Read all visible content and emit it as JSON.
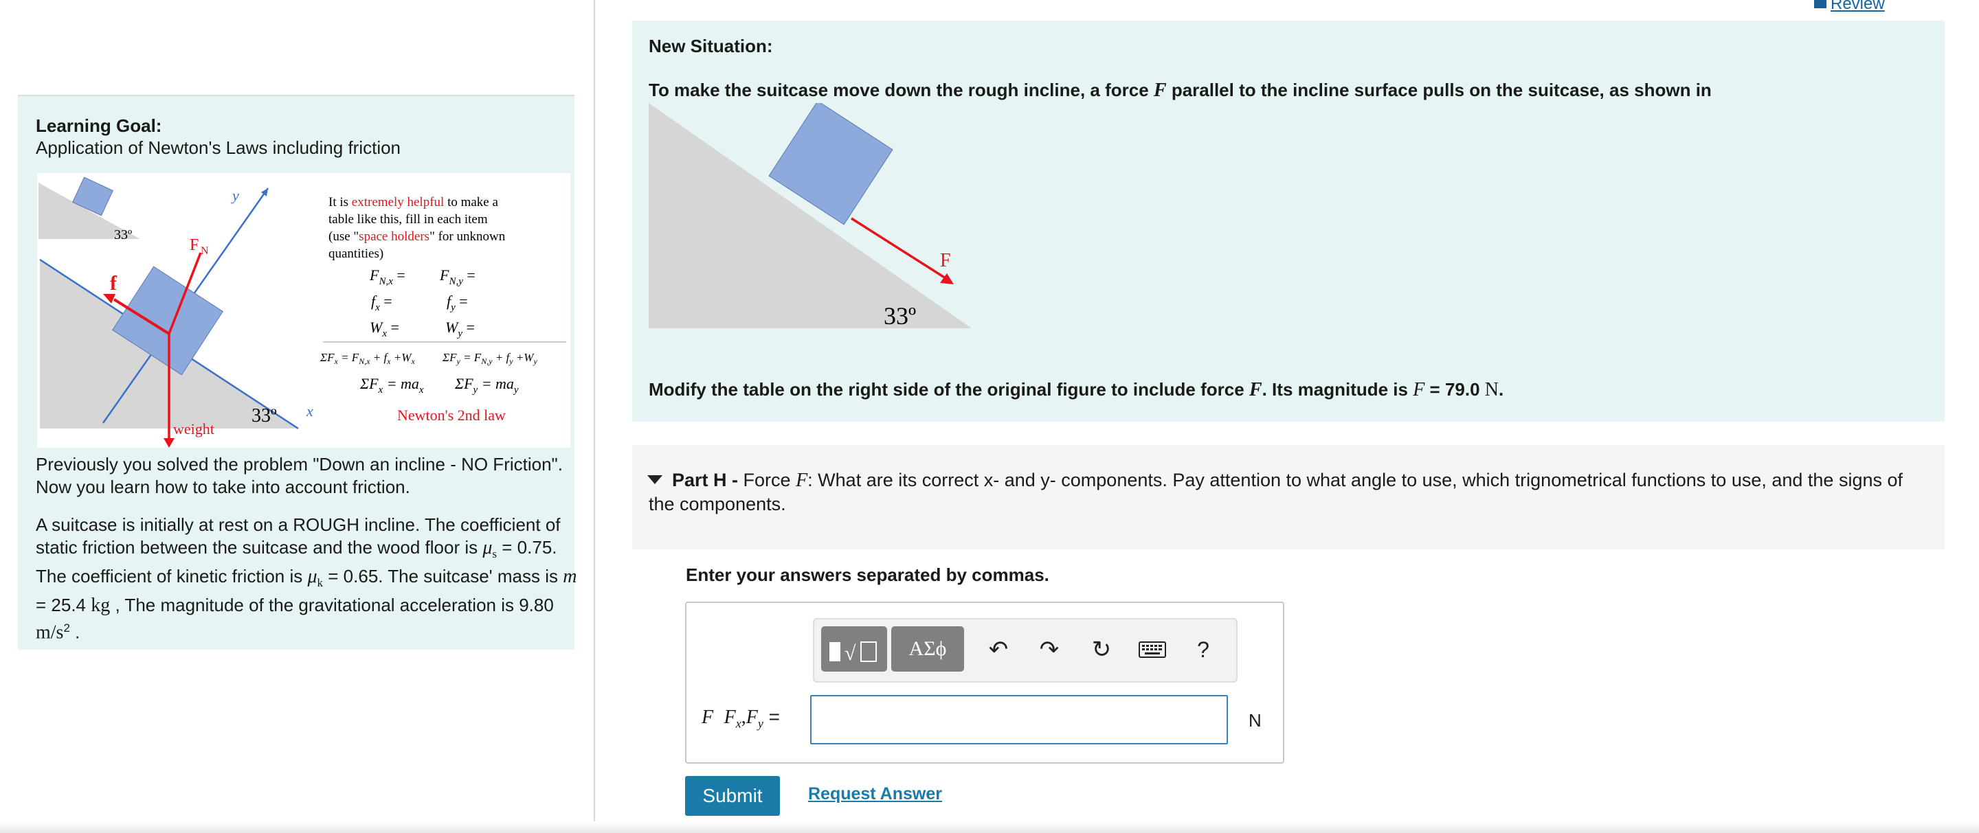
{
  "left": {
    "title": "Learning Goal:",
    "subtitle": "Application of Newton's Laws including friction",
    "figure": {
      "angle_small": "33º",
      "angle_main": "33º",
      "label_y": "y",
      "label_x": "x",
      "label_fn": "F",
      "label_fn_sub": "N",
      "label_f": "f",
      "label_weight": "weight",
      "note_line1_a": "It is ",
      "note_line1_b": "extremely helpful",
      "note_line1_c": " to make a",
      "note_line2": "table like this, fill in each item",
      "note_line3_a": "(use \"",
      "note_line3_b": "space holders",
      "note_line3_c": "\" for unknown",
      "note_line4": "quantities)",
      "eq_r1_l": "F",
      "eq_r1_l_sub": "N,x",
      "eq_r1_r": "F",
      "eq_r1_r_sub": "N,y",
      "eq_r2_l": "f",
      "eq_r2_r": "f",
      "eq_r3_l": "W",
      "eq_r3_r": "W",
      "sum_x": "ΣF",
      "sum_y": "ΣF",
      "newton": "Newton's 2nd law"
    },
    "prev_text": "Previously you solved the problem \"Down an incline - NO Friction\". Now you learn how to take into account friction.",
    "prob_a": "A suitcase is initially at rest on a ROUGH incline. The coefficient of static friction between the suitcase and the wood floor is ",
    "mu_s_sym": "μ",
    "mu_s_sub": "s",
    "mu_s_val": " = 0.75",
    "prob_b": ". The coefficient of kinetic friction is ",
    "mu_k_sym": "μ",
    "mu_k_sub": "k",
    "mu_k_val": " = 0.65",
    "prob_c": ". The suitcase' mass is ",
    "m_sym": "m",
    "m_val": " = 25.4 ",
    "m_unit": "kg",
    "prob_d": " , The magnitude of the gravitational acceleration is 9.80 ",
    "g_unit": "m/s",
    "g_exp": "2",
    "prob_e": " ."
  },
  "review": {
    "label": "Review"
  },
  "situation": {
    "title": "New Situation:",
    "text_a": "To make the suitcase move down the rough incline, a force ",
    "force_sym": "F",
    "text_b": " parallel to the incline surface pulls on the suitcase, as shown in",
    "fig_force_label": "F",
    "fig_angle": "33º",
    "modify_a": "Modify the table on the right side of the original figure to include force ",
    "modify_b": ". Its magnitude is ",
    "modify_val": " = 79.0 ",
    "modify_unit": "N",
    "modify_end": "."
  },
  "part": {
    "label": "Part H - ",
    "text_a": "Force ",
    "text_b": ": What are its correct x- and y- components. Pay attention to what angle to use, which trignometrical functions to use, and the signs of the components."
  },
  "answer": {
    "instructions": "Enter your answers separated by commas.",
    "greek_btn": "ΑΣϕ",
    "help_btn": "?",
    "label_sym": "F",
    "label_fx": "F",
    "label_fx_sub": "x",
    "label_fy": "F",
    "label_fy_sub": "y",
    "label_eq": " =",
    "input_value": "",
    "unit": "N",
    "submit": "Submit",
    "request": "Request Answer"
  },
  "colors": {
    "panel_bg": "#e6f4f4",
    "submit_bg": "#1a7aa8",
    "box_blue": "#8ea9db",
    "arrow_red": "#e8141c"
  }
}
